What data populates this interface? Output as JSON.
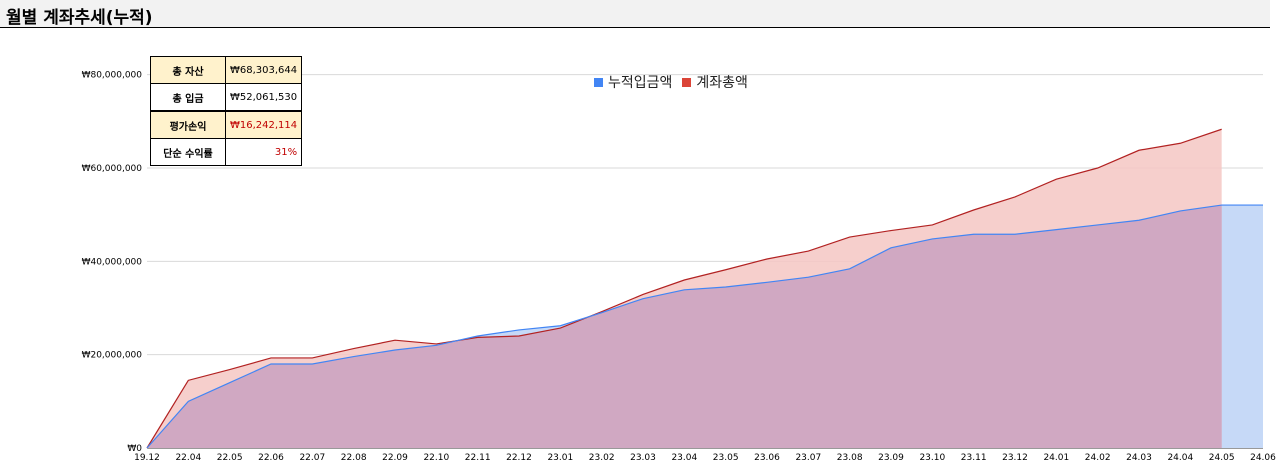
{
  "page": {
    "title": "월별 계좌추세(누적)"
  },
  "summary": {
    "rows": [
      {
        "label": "총 자산",
        "value": "₩68,303,644"
      },
      {
        "label": "총 입금",
        "value": "₩52,061,530"
      },
      {
        "label": "평가손익",
        "value": "₩16,242,114"
      },
      {
        "label": "단순 수익률",
        "value": "31%"
      }
    ]
  },
  "colors": {
    "deposit": "#4285f4",
    "total": "#db4437",
    "deposit_fill": "#c6d9f7",
    "total_fill": "#f4c7c3",
    "overlap_fill": "#d0a8c2"
  },
  "chart_data": {
    "type": "area",
    "title": "",
    "xlabel": "",
    "ylabel": "",
    "ylim": [
      0,
      90000000
    ],
    "yticks": [
      {
        "value": 0,
        "label": "₩0"
      },
      {
        "value": 20000000,
        "label": "₩20,000,000"
      },
      {
        "value": 40000000,
        "label": "₩40,000,000"
      },
      {
        "value": 60000000,
        "label": "₩60,000,000"
      },
      {
        "value": 80000000,
        "label": "₩80,000,000"
      }
    ],
    "x": [
      "19.12",
      "22.04",
      "22.05",
      "22.06",
      "22.07",
      "22.08",
      "22.09",
      "22.10",
      "22.11",
      "22.12",
      "23.01",
      "23.02",
      "23.03",
      "23.04",
      "23.05",
      "23.06",
      "23.07",
      "23.08",
      "23.09",
      "23.10",
      "23.11",
      "23.12",
      "24.01",
      "24.02",
      "24.03",
      "24.04",
      "24.05",
      "24.06"
    ],
    "legend_position": "top",
    "grid": true,
    "series": [
      {
        "name": "누적입금액",
        "values": [
          0,
          10000000,
          14000000,
          18000000,
          18000000,
          19600000,
          21000000,
          22000000,
          24000000,
          25300000,
          26200000,
          29000000,
          32000000,
          33900000,
          34500000,
          35500000,
          36600000,
          38400000,
          42900000,
          44800000,
          45800000,
          45800000,
          46800000,
          47800000,
          48800000,
          50800000,
          52061530,
          52061530
        ]
      },
      {
        "name": "계좌총액",
        "values": [
          0,
          14500000,
          16800000,
          19300000,
          19300000,
          21300000,
          23100000,
          22300000,
          23700000,
          24000000,
          25700000,
          29200000,
          32900000,
          36000000,
          38200000,
          40500000,
          42200000,
          45200000,
          46600000,
          47800000,
          51000000,
          53800000,
          57600000,
          60000000,
          63800000,
          65300000,
          68303644,
          null
        ]
      }
    ]
  }
}
